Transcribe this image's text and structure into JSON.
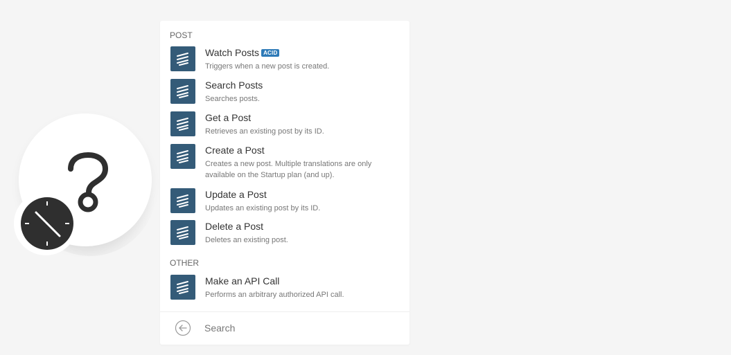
{
  "module": {
    "app_icon": "question-mark-icon",
    "trigger_badge_icon": "clock-icon"
  },
  "panel": {
    "sections": [
      {
        "header": "POST",
        "items": [
          {
            "title": "Watch Posts",
            "badge": "ACID",
            "description": "Triggers when a new post is created."
          },
          {
            "title": "Search Posts",
            "description": "Searches posts."
          },
          {
            "title": "Get a Post",
            "description": "Retrieves an existing post by its ID."
          },
          {
            "title": "Create a Post",
            "description": "Creates a new post. Multiple translations are only available on the Startup plan (and up)."
          },
          {
            "title": "Update a Post",
            "description": "Updates an existing post by its ID."
          },
          {
            "title": "Delete a Post",
            "description": "Deletes an existing post."
          }
        ]
      },
      {
        "header": "OTHER",
        "items": [
          {
            "title": "Make an API Call",
            "description": "Performs an arbitrary authorized API call."
          }
        ]
      }
    ],
    "search": {
      "placeholder": "Search"
    }
  },
  "colors": {
    "icon_background": "#345b78",
    "badge": "#2d7ab7",
    "clock": "#2f2f2f"
  }
}
